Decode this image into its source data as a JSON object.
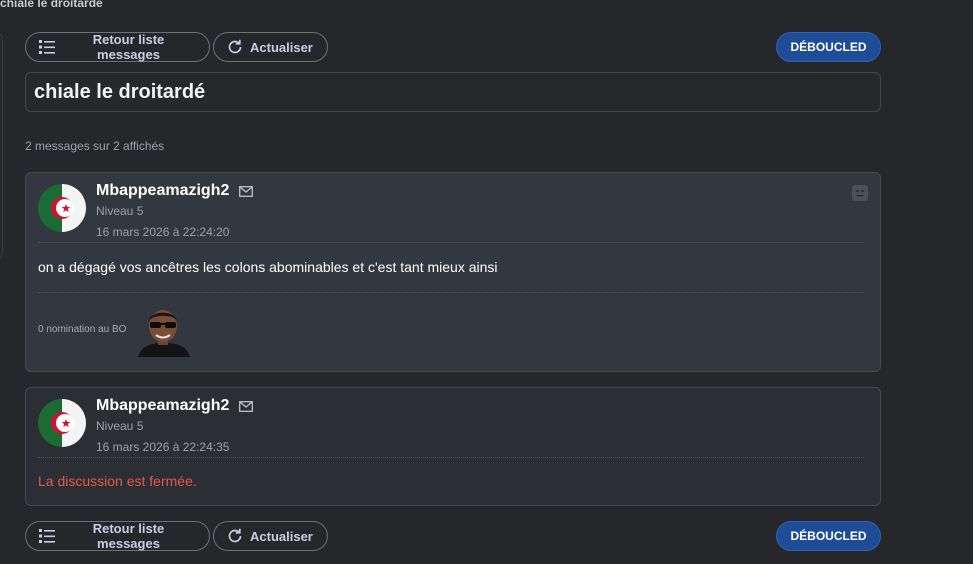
{
  "header": {
    "title": "chiale le droitarde"
  },
  "toolbar": {
    "back_label": "Retour liste messages",
    "refresh_label": "Actualiser",
    "lock_label": "DÉBOUCLED",
    "back_icon": "list-icon",
    "refresh_icon": "refresh-icon"
  },
  "topic": {
    "title": "chiale le droitardé"
  },
  "messages_info": {
    "count_text": "2 messages sur 2 affichés"
  },
  "messages": [
    {
      "author": "Mbappeamazigh2",
      "level": "Niveau 5",
      "timestamp": "16 mars 2026 à 22:24:20",
      "body": "on a dégagé vos ancêtres les colons abominables et c'est tant mieux ainsi",
      "nomination": "0 nomination au BO",
      "avatar": "algeria-flag-avatar",
      "sticker": "person-with-sunglasses-sticker"
    },
    {
      "author": "Mbappeamazigh2",
      "level": "Niveau 5",
      "timestamp": "16 mars 2026 à 22:24:35",
      "body": "La discussion est fermée.",
      "avatar": "algeria-flag-avatar"
    }
  ],
  "colors": {
    "background": "#25272b",
    "card": "#333740",
    "accent_button": "#1e4c96",
    "closed_text": "#e8594b"
  }
}
